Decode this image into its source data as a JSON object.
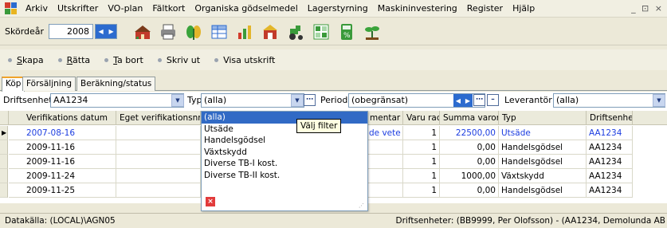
{
  "menu": [
    "Arkiv",
    "Utskrifter",
    "VO-plan",
    "Fältkort",
    "Organiska gödselmedel",
    "Lagerstyrning",
    "Maskininvestering",
    "Register",
    "Hjälp"
  ],
  "window_controls": "_ ⊡ ×",
  "toolbar": {
    "year_label": "Skördeår",
    "year_value": "2008",
    "icons": [
      "barn-icon",
      "printer-icon",
      "plant-icon",
      "table-icon",
      "chart-icon",
      "storage-icon",
      "tractor-icon",
      "grid-icon",
      "calculator-icon",
      "seedling-icon"
    ]
  },
  "actions": [
    {
      "pre": "",
      "u": "S",
      "post": "kapa"
    },
    {
      "pre": "",
      "u": "R",
      "post": "ätta"
    },
    {
      "pre": "",
      "u": "T",
      "post": "a bort"
    },
    {
      "pre": "Skriv ut",
      "u": "",
      "post": ""
    },
    {
      "pre": "Visa utskrift",
      "u": "",
      "post": ""
    }
  ],
  "tabs": [
    "Köp",
    "Försäljning",
    "Beräkning/status"
  ],
  "filters": {
    "driftsenhet_label": "Driftsenhet",
    "driftsenhet_value": "AA1234",
    "typ_label": "Typ",
    "typ_value": "(alla)",
    "period_label": "Period",
    "period_value": "(obegränsat)",
    "leverantor_label": "Leverantör",
    "leverantor_value": "(alla)"
  },
  "grid": {
    "headers": [
      "Verifikations datum",
      "Eget verifikationsnr.",
      "mentar",
      "Varu rad",
      "Summa varor",
      "Typ",
      "Driftsenhet"
    ],
    "rows": [
      {
        "date": "2007-08-16",
        "note": "de vete",
        "qty": "1",
        "sum": "22500,00",
        "type": "Utsäde",
        "unit": "AA1234",
        "current": true
      },
      {
        "date": "2009-11-16",
        "note": "",
        "qty": "1",
        "sum": "0,00",
        "type": "Handelsgödsel",
        "unit": "AA1234",
        "current": false
      },
      {
        "date": "2009-11-16",
        "note": "",
        "qty": "1",
        "sum": "0,00",
        "type": "Handelsgödsel",
        "unit": "AA1234",
        "current": false
      },
      {
        "date": "2009-11-24",
        "note": "",
        "qty": "1",
        "sum": "1000,00",
        "type": "Växtskydd",
        "unit": "AA1234",
        "current": false
      },
      {
        "date": "2009-11-25",
        "note": "",
        "qty": "1",
        "sum": "0,00",
        "type": "Handelsgödsel",
        "unit": "AA1234",
        "current": false
      }
    ]
  },
  "popup": {
    "options": [
      "(alla)",
      "Utsäde",
      "Handelsgödsel",
      "Växtskydd",
      "Diverse TB-I kost.",
      "Diverse TB-II kost."
    ],
    "selected_index": 0,
    "tooltip": "Välj filter"
  },
  "status": {
    "left": "Datakälla: (LOCAL)\\AGN05",
    "right": "Driftsenheter: (BB9999, Per Olofsson) - (AA1234, Demolunda AB"
  },
  "colors": {
    "accent": "#316ac5",
    "link_text": "#1c3de0",
    "tab_highlight": "#f0a32a",
    "spin_button": "#2c6bcf",
    "close_red": "#e23b3b"
  }
}
